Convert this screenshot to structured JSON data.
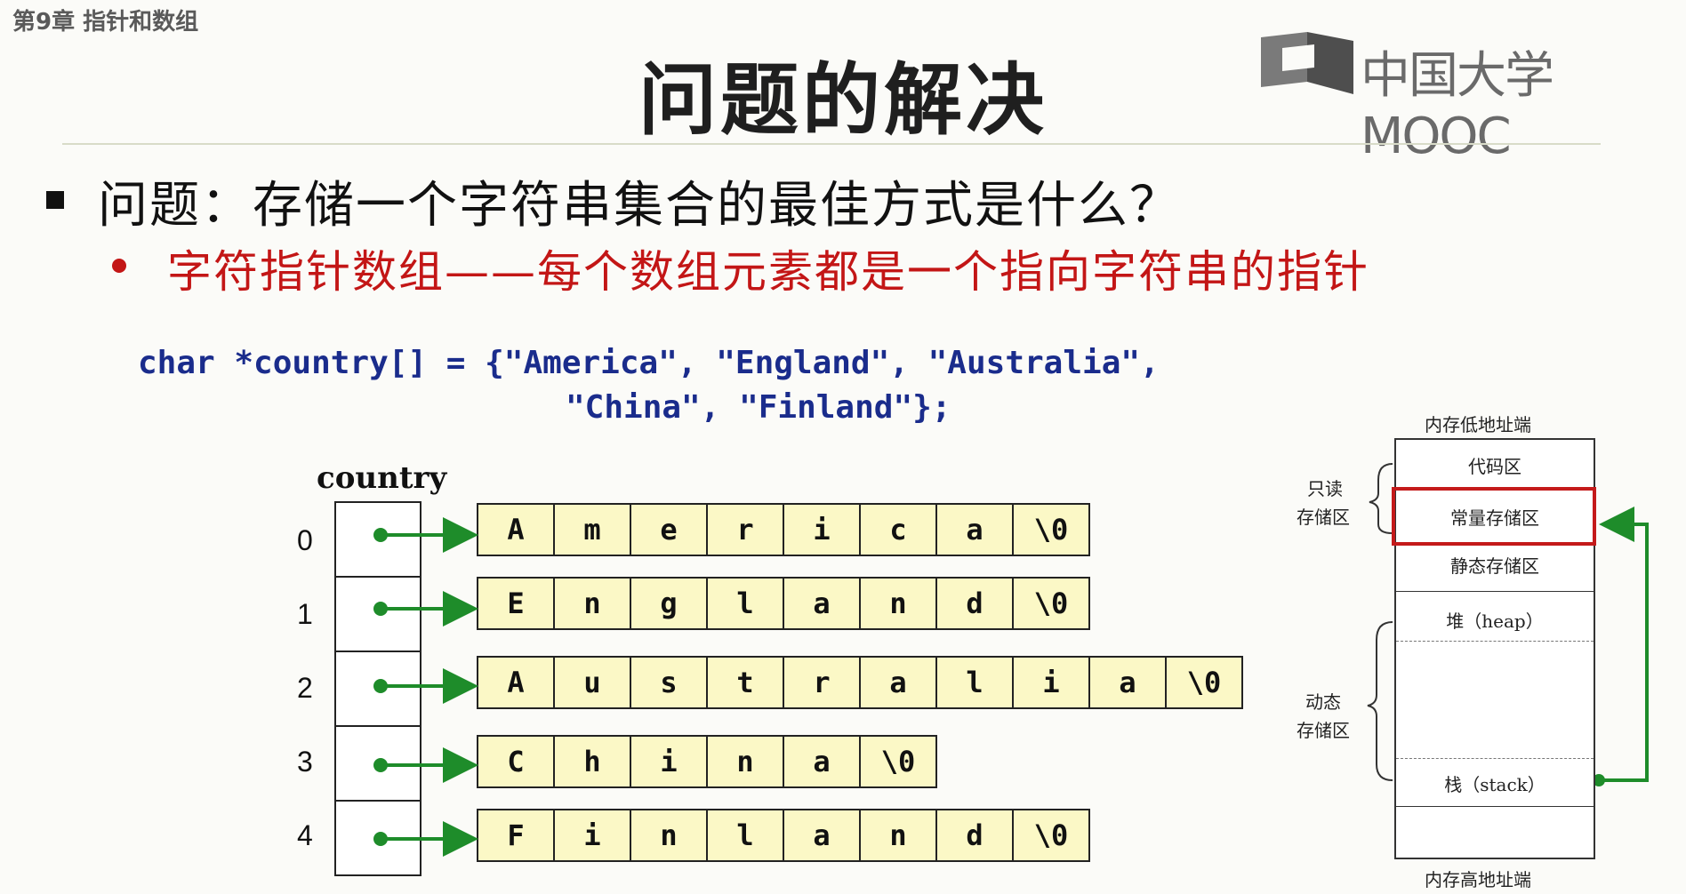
{
  "header": {
    "chapter": "第9章 指针和数组",
    "title": "问题的解决",
    "logo_text": "中国大学MOOC"
  },
  "content": {
    "question": "问题：存储一个字符串集合的最佳方式是什么？",
    "answer": "字符指针数组——每个数组元素都是一个指向字符串的指针",
    "code_line1": "char *country[] = {\"America\", \"England\", \"Australia\",",
    "code_line2": "\"China\", \"Finland\"};"
  },
  "diagram": {
    "array_name": "country",
    "indices": [
      "0",
      "1",
      "2",
      "3",
      "4"
    ],
    "strings": [
      [
        "A",
        "m",
        "e",
        "r",
        "i",
        "c",
        "a",
        "\\0"
      ],
      [
        "E",
        "n",
        "g",
        "l",
        "a",
        "n",
        "d",
        "\\0"
      ],
      [
        "A",
        "u",
        "s",
        "t",
        "r",
        "a",
        "l",
        "i",
        "a",
        "\\0"
      ],
      [
        "C",
        "h",
        "i",
        "n",
        "a",
        "\\0"
      ],
      [
        "F",
        "i",
        "n",
        "l",
        "a",
        "n",
        "d",
        "\\0"
      ]
    ],
    "arrow_color": "#1e8c2a"
  },
  "memory": {
    "top_label": "内存低地址端",
    "bottom_label": "内存高地址端",
    "readonly_label_1": "只读",
    "readonly_label_2": "存储区",
    "dynamic_label_1": "动态",
    "dynamic_label_2": "存储区",
    "sections": {
      "code": "代码区",
      "const": "常量存储区",
      "static": "静态存储区",
      "heap": "堆（heap）",
      "stack": "栈（stack）"
    },
    "highlight_color": "#c41a1a"
  }
}
